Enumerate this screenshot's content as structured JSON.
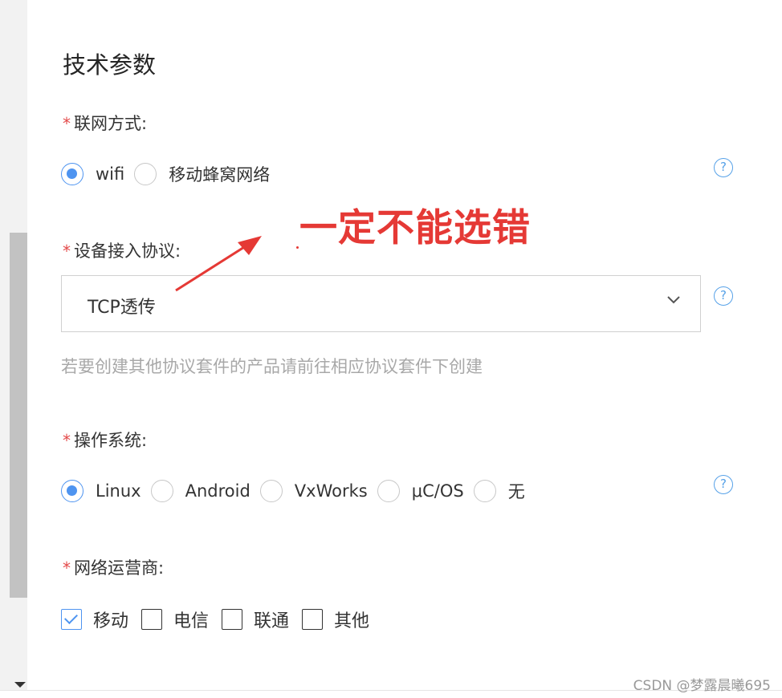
{
  "section_title": "技术参数",
  "network": {
    "label": "联网方式:",
    "required_mark": "*",
    "options": [
      {
        "label": "wifi",
        "checked": true
      },
      {
        "label": "移动蜂窝网络",
        "checked": false
      }
    ]
  },
  "protocol": {
    "label": "设备接入协议:",
    "required_mark": "*",
    "selected": "TCP透传",
    "hint": "若要创建其他协议套件的产品请前往相应协议套件下创建"
  },
  "os": {
    "label": "操作系统:",
    "required_mark": "*",
    "options": [
      {
        "label": "Linux",
        "checked": true
      },
      {
        "label": "Android",
        "checked": false
      },
      {
        "label": "VxWorks",
        "checked": false
      },
      {
        "label": "μC/OS",
        "checked": false
      },
      {
        "label": "无",
        "checked": false
      }
    ]
  },
  "carrier": {
    "label": "网络运营商:",
    "required_mark": "*",
    "options": [
      {
        "label": "移动",
        "checked": true
      },
      {
        "label": "电信",
        "checked": false
      },
      {
        "label": "联通",
        "checked": false
      },
      {
        "label": "其他",
        "checked": false
      }
    ]
  },
  "help_glyph": "?",
  "annotation": {
    "text": "一定不能选错",
    "color": "#e53935"
  },
  "watermark": "CSDN @梦露晨曦695",
  "colors": {
    "accent": "#4e94f0",
    "required": "#e34a4a",
    "hint": "#a8a8a8"
  }
}
